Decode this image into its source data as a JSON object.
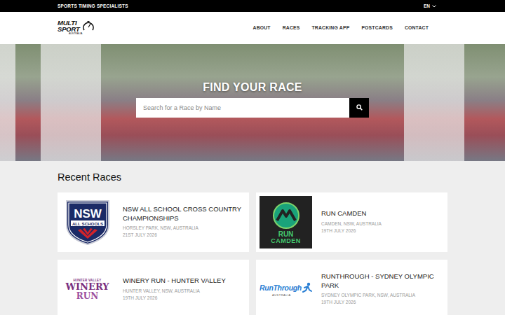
{
  "top_bar": {
    "tagline": "SPORTS TIMING SPECIALISTS",
    "language": "EN"
  },
  "logo": {
    "lines": [
      "MULTI",
      "SPORT"
    ],
    "subtitle": "AUSTRALIA"
  },
  "nav": [
    {
      "label": "ABOUT",
      "selected": false
    },
    {
      "label": "RACES",
      "selected": false
    },
    {
      "label": "TRACKING APP",
      "selected": false
    },
    {
      "label": "POSTCARDS",
      "selected": false
    },
    {
      "label": "CONTACT",
      "selected": false
    }
  ],
  "hero": {
    "title": "FIND YOUR RACE",
    "search": {
      "placeholder": "Search for a Race by Name"
    }
  },
  "recent": {
    "heading": "Recent Races",
    "races": [
      {
        "title": "NSW ALL SCHOOL CROSS COUNTRY CHAMPIONSHIPS",
        "location": "HORSLEY PARK, NSW, AUSTRALIA",
        "date": "21ST JULY 2026",
        "logo": {
          "kind": "nsw",
          "lines": [
            "NSW",
            "ALL SCHOOLS"
          ]
        }
      },
      {
        "title": "RUN CAMDEN",
        "location": "CAMDEN, NSW, AUSTRALIA",
        "date": "19TH JULY 2026",
        "logo": {
          "kind": "camden",
          "lines": [
            "RUN",
            "CAMDEN"
          ]
        }
      },
      {
        "title": "WINERY RUN - HUNTER VALLEY",
        "location": "HUNTER VALLEY, NSW, AUSTRALIA",
        "date": "19TH JULY 2026",
        "logo": {
          "kind": "winery",
          "lines": [
            "HUNTER VALLEY",
            "WINERY",
            "RUN"
          ]
        }
      },
      {
        "title": "RUNTHROUGH - SYDNEY OLYMPIC PARK",
        "location": "SYDNEY OLYMPIC PARK, NSW, AUSTRALIA",
        "date": "19TH JULY 2026",
        "logo": {
          "kind": "runthrough",
          "lines": [
            "RunThrough",
            "AUSTRALIA"
          ]
        }
      }
    ]
  }
}
